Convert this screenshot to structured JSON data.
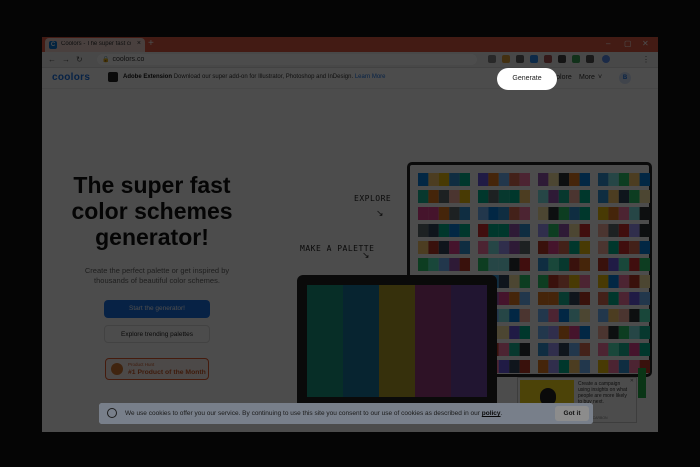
{
  "browser": {
    "tab_title": "Coolors - The super fast color s...",
    "tab_favicon": "C",
    "tab_close": "×",
    "new_tab": "+",
    "window_controls": [
      "–",
      "▢",
      "✕"
    ],
    "url": "coolors.co",
    "nav_icons": [
      "back-icon",
      "forward-icon",
      "reload-icon"
    ]
  },
  "site": {
    "logo": "coolors",
    "promo_title": "Adobe Extension",
    "promo_text": "Download our super add-on for Illustrator, Photoshop and InDesign.",
    "promo_link": "Learn More",
    "nav_generate": "Generate",
    "nav_explore": "Explore",
    "nav_more": "More",
    "avatar": "B"
  },
  "hero": {
    "title": "The super fast color schemes generator!",
    "subtitle": "Create the perfect palette or get inspired by thousands of beautiful color schemes.",
    "start_button": "Start the generator!",
    "explore_button": "Explore trending palettes",
    "ph_small": "Product Hunt",
    "ph_big": "#1 Product of the Month",
    "explore_hand": "EXPLORE",
    "palette_hand": "MAKE A PALETTE"
  },
  "ad": {
    "brand": "mailchimp",
    "text": "Create a campaign using insights on what people are more likely to buy next.",
    "close": "✕",
    "tag": "ADS VIA CARBON"
  },
  "cookie": {
    "text": "We use cookies to offer you our service. By continuing to use this site you consent to our use of cookies as described in our",
    "policy": "policy",
    "button": "Got it"
  },
  "colors": {
    "laptop_stripes": [
      "#1a9c84",
      "#1a78a0",
      "#b5a12a",
      "#9c3d7f",
      "#6f48a6"
    ],
    "accent": "#1a73e8",
    "tabbar": "#e25c45"
  }
}
